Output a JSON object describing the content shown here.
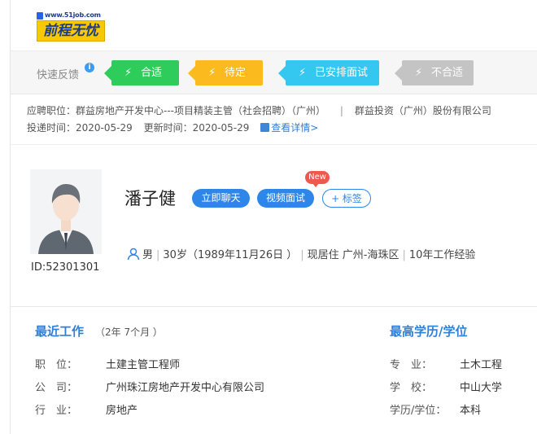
{
  "header": {
    "logo_url_text": "www.51job.com",
    "logo_brand_text": "前程无忧"
  },
  "feedback": {
    "label": "快速反馈",
    "info_icon": "i",
    "bolt_icon": "⚡",
    "buttons": [
      {
        "label": "合适",
        "color": "#2ecc5a"
      },
      {
        "label": "待定",
        "color": "#fbba1d"
      },
      {
        "label": "已安排面试",
        "color": "#34c7f0"
      },
      {
        "label": "不合适",
        "color": "#c4c4c4"
      }
    ]
  },
  "job_info": {
    "position_label": "应聘职位：",
    "position_value": "群益房地产开发中心---项目精装主管（社会招聘）（广州）",
    "divider": "|",
    "company_value": "群益投资（广州）股份有限公司",
    "apply_time_label": "投递时间：",
    "apply_time_value": "2020-05-29",
    "update_time_label": "更新时间：",
    "update_time_value": "2020-05-29",
    "detail_link": "查看详情>"
  },
  "profile": {
    "name": "潘子健",
    "chat_button": "立即聊天",
    "video_button": "视频面试",
    "new_badge": "New",
    "tag_button": "+ 标签",
    "id_text": "ID:52301301",
    "gender": "男",
    "age": "30岁（1989年11月26日 ）",
    "residence": "现居住 广州-海珠区",
    "experience": "10年工作经验"
  },
  "recent_work": {
    "title": "最近工作",
    "duration": "（2年 7个月 ）",
    "fields": [
      {
        "label": "职　位：",
        "value": "土建主管工程师"
      },
      {
        "label": "公　司：",
        "value": "广州珠江房地产开发中心有限公司"
      },
      {
        "label": "行　业：",
        "value": "房地产"
      }
    ]
  },
  "education": {
    "title": "最高学历/学位",
    "fields": [
      {
        "label": "专　业：",
        "value": "土木工程"
      },
      {
        "label": "学　校：",
        "value": "中山大学"
      },
      {
        "label": "学历/学位：",
        "value": "本科"
      }
    ]
  },
  "colors": {
    "accent": "#2e86e8",
    "section_title": "#2f7fd6"
  }
}
